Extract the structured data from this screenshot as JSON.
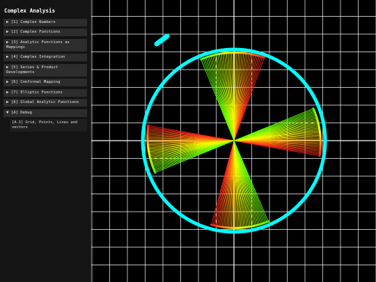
{
  "app": {
    "title": "Complex Analysis"
  },
  "sidebar": {
    "items": [
      {
        "label": "▶ [1] Complex Numbers"
      },
      {
        "label": "▶ [2] Complex Functions"
      },
      {
        "label": "▶ [3] Analytic Functions as Mappings"
      },
      {
        "label": "▶ [4] Complex Integration"
      },
      {
        "label": "▶ [5] Series & Product Developments"
      },
      {
        "label": "▶ [6] Conformal Mapping"
      },
      {
        "label": "▶ [7] Elliptic Functions"
      },
      {
        "label": "▶ [8] Global Analytic Functions"
      },
      {
        "label": "▼ [A] Debug"
      }
    ],
    "subitems": [
      {
        "label": "[A.1] Grid, Points, Lines and vectors"
      }
    ]
  },
  "colors": {
    "background": "#000000",
    "grid": "#ffffff",
    "circle": "#00ffff",
    "red": "#ff1a1a",
    "yellow": "#ffff00",
    "green": "#55ff00",
    "sidebar": "#141414",
    "nav_item": "#2d2d2d"
  }
}
